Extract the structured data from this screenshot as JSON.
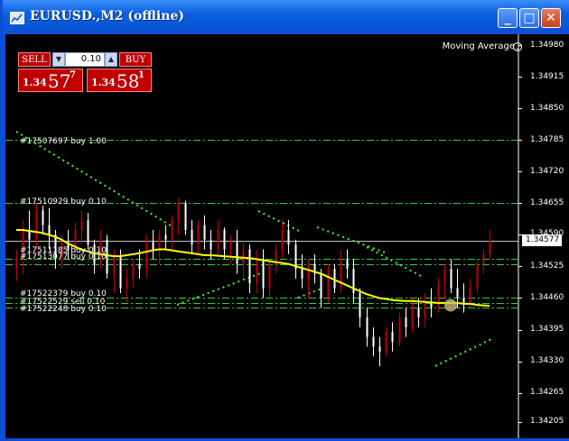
{
  "window": {
    "title": "EURUSD.,M2 (offline)"
  },
  "titlebar_buttons": {
    "minimize": "_",
    "maximize": "□",
    "close": "✕"
  },
  "trade_panel": {
    "sell_label": "SELL",
    "buy_label": "BUY",
    "lot_value": "0.10",
    "sell_price": {
      "prefix": "1.34",
      "big": "57",
      "sup": "7"
    },
    "buy_price": {
      "prefix": "1.34",
      "big": "58",
      "sup": "1"
    }
  },
  "indicator": {
    "name": "Moving Average"
  },
  "orders": [
    {
      "text": "#17507697 buy 1.00"
    },
    {
      "text": "#17510929 buy 0.10"
    },
    {
      "text": "#17511185 buy 0.10"
    },
    {
      "text": "#17513077 buy 0.10"
    },
    {
      "text": "#17522379 buy 0.10"
    },
    {
      "text": "#17522529 sell 0.10"
    },
    {
      "text": "#17522248 buy 0.10"
    }
  ],
  "price_axis": [
    "1.34980",
    "1.34915",
    "1.34850",
    "1.34785",
    "1.34720",
    "1.34655",
    "1.34590",
    "1.34525",
    "1.34460",
    "1.34395",
    "1.34330",
    "1.34265",
    "1.34205"
  ],
  "current_price": "1.34577",
  "colors": {
    "bull": "#c00000",
    "bear": "#ffffff",
    "ma": "#ffff00",
    "order_line": "#33cc33",
    "trend_dots": "#33ff33"
  },
  "chart_data": {
    "type": "candlestick",
    "symbol": "EURUSD.",
    "timeframe": "M2",
    "ylim": [
      1.34205,
      1.3498
    ],
    "y_ticks": [
      1.3498,
      1.34915,
      1.3485,
      1.34785,
      1.3472,
      1.34655,
      1.3459,
      1.34525,
      1.3446,
      1.34395,
      1.3433,
      1.34265,
      1.34205
    ],
    "current": 1.34577,
    "order_levels": [
      1.34785,
      1.34655,
      1.3454,
      1.3453,
      1.3446,
      1.3445,
      1.3444
    ],
    "ohlc": [
      {
        "o": 1.3452,
        "h": 1.3456,
        "l": 1.34495,
        "c": 1.3454
      },
      {
        "o": 1.3454,
        "h": 1.3462,
        "l": 1.3451,
        "c": 1.346
      },
      {
        "o": 1.346,
        "h": 1.3464,
        "l": 1.3456,
        "c": 1.3458
      },
      {
        "o": 1.3458,
        "h": 1.34655,
        "l": 1.3456,
        "c": 1.3464
      },
      {
        "o": 1.3464,
        "h": 1.3465,
        "l": 1.3459,
        "c": 1.3461
      },
      {
        "o": 1.3461,
        "h": 1.34645,
        "l": 1.3456,
        "c": 1.3459
      },
      {
        "o": 1.3459,
        "h": 1.346,
        "l": 1.3452,
        "c": 1.3454
      },
      {
        "o": 1.3454,
        "h": 1.3459,
        "l": 1.3452,
        "c": 1.34575
      },
      {
        "o": 1.34575,
        "h": 1.346,
        "l": 1.3454,
        "c": 1.3456
      },
      {
        "o": 1.3456,
        "h": 1.34615,
        "l": 1.3453,
        "c": 1.346
      },
      {
        "o": 1.346,
        "h": 1.3464,
        "l": 1.3457,
        "c": 1.3462
      },
      {
        "o": 1.3462,
        "h": 1.34635,
        "l": 1.3456,
        "c": 1.3457
      },
      {
        "o": 1.3457,
        "h": 1.3458,
        "l": 1.3451,
        "c": 1.3453
      },
      {
        "o": 1.3453,
        "h": 1.346,
        "l": 1.3452,
        "c": 1.3458
      },
      {
        "o": 1.3458,
        "h": 1.3459,
        "l": 1.345,
        "c": 1.3451
      },
      {
        "o": 1.3451,
        "h": 1.3456,
        "l": 1.3447,
        "c": 1.34545
      },
      {
        "o": 1.34545,
        "h": 1.3456,
        "l": 1.3447,
        "c": 1.3448
      },
      {
        "o": 1.3448,
        "h": 1.3452,
        "l": 1.3445,
        "c": 1.345
      },
      {
        "o": 1.345,
        "h": 1.3454,
        "l": 1.3448,
        "c": 1.3453
      },
      {
        "o": 1.3453,
        "h": 1.3456,
        "l": 1.345,
        "c": 1.3452
      },
      {
        "o": 1.3452,
        "h": 1.3459,
        "l": 1.345,
        "c": 1.34575
      },
      {
        "o": 1.34575,
        "h": 1.346,
        "l": 1.3454,
        "c": 1.3456
      },
      {
        "o": 1.3456,
        "h": 1.346,
        "l": 1.3453,
        "c": 1.3459
      },
      {
        "o": 1.3459,
        "h": 1.3461,
        "l": 1.3456,
        "c": 1.3458
      },
      {
        "o": 1.3458,
        "h": 1.3463,
        "l": 1.3456,
        "c": 1.3462
      },
      {
        "o": 1.3462,
        "h": 1.34665,
        "l": 1.3459,
        "c": 1.34655
      },
      {
        "o": 1.34655,
        "h": 1.3466,
        "l": 1.3459,
        "c": 1.346
      },
      {
        "o": 1.346,
        "h": 1.3462,
        "l": 1.3455,
        "c": 1.3457
      },
      {
        "o": 1.3457,
        "h": 1.3462,
        "l": 1.3455,
        "c": 1.3461
      },
      {
        "o": 1.3461,
        "h": 1.3463,
        "l": 1.3456,
        "c": 1.3458
      },
      {
        "o": 1.3458,
        "h": 1.346,
        "l": 1.3454,
        "c": 1.3456
      },
      {
        "o": 1.3456,
        "h": 1.3462,
        "l": 1.3455,
        "c": 1.346
      },
      {
        "o": 1.346,
        "h": 1.34605,
        "l": 1.3454,
        "c": 1.3456
      },
      {
        "o": 1.3456,
        "h": 1.3459,
        "l": 1.3453,
        "c": 1.34575
      },
      {
        "o": 1.34575,
        "h": 1.346,
        "l": 1.3451,
        "c": 1.3453
      },
      {
        "o": 1.3453,
        "h": 1.3458,
        "l": 1.345,
        "c": 1.3456
      },
      {
        "o": 1.3456,
        "h": 1.3457,
        "l": 1.3447,
        "c": 1.3449
      },
      {
        "o": 1.3449,
        "h": 1.3456,
        "l": 1.3447,
        "c": 1.3454
      },
      {
        "o": 1.3454,
        "h": 1.3456,
        "l": 1.3446,
        "c": 1.3448
      },
      {
        "o": 1.3448,
        "h": 1.3454,
        "l": 1.3446,
        "c": 1.3453
      },
      {
        "o": 1.3453,
        "h": 1.3457,
        "l": 1.3451,
        "c": 1.3456
      },
      {
        "o": 1.3456,
        "h": 1.3462,
        "l": 1.3454,
        "c": 1.346
      },
      {
        "o": 1.346,
        "h": 1.3462,
        "l": 1.3455,
        "c": 1.3457
      },
      {
        "o": 1.3457,
        "h": 1.3458,
        "l": 1.345,
        "c": 1.3452
      },
      {
        "o": 1.3452,
        "h": 1.3455,
        "l": 1.3448,
        "c": 1.345
      },
      {
        "o": 1.345,
        "h": 1.3454,
        "l": 1.3446,
        "c": 1.3453
      },
      {
        "o": 1.3453,
        "h": 1.3455,
        "l": 1.3449,
        "c": 1.3451
      },
      {
        "o": 1.3451,
        "h": 1.3452,
        "l": 1.3444,
        "c": 1.3446
      },
      {
        "o": 1.3446,
        "h": 1.3453,
        "l": 1.3445,
        "c": 1.3452
      },
      {
        "o": 1.3452,
        "h": 1.3453,
        "l": 1.3447,
        "c": 1.3448
      },
      {
        "o": 1.3448,
        "h": 1.3456,
        "l": 1.3447,
        "c": 1.3454
      },
      {
        "o": 1.3454,
        "h": 1.3456,
        "l": 1.345,
        "c": 1.3452
      },
      {
        "o": 1.3452,
        "h": 1.3454,
        "l": 1.3445,
        "c": 1.3447
      },
      {
        "o": 1.3447,
        "h": 1.3448,
        "l": 1.344,
        "c": 1.3442
      },
      {
        "o": 1.3442,
        "h": 1.3444,
        "l": 1.3436,
        "c": 1.3438
      },
      {
        "o": 1.3438,
        "h": 1.344,
        "l": 1.3434,
        "c": 1.3436
      },
      {
        "o": 1.3436,
        "h": 1.3438,
        "l": 1.3432,
        "c": 1.3435
      },
      {
        "o": 1.3435,
        "h": 1.344,
        "l": 1.3434,
        "c": 1.3439
      },
      {
        "o": 1.3439,
        "h": 1.3441,
        "l": 1.3435,
        "c": 1.3437
      },
      {
        "o": 1.3437,
        "h": 1.3443,
        "l": 1.3436,
        "c": 1.3442
      },
      {
        "o": 1.3442,
        "h": 1.3444,
        "l": 1.3438,
        "c": 1.344
      },
      {
        "o": 1.344,
        "h": 1.3446,
        "l": 1.3439,
        "c": 1.3444
      },
      {
        "o": 1.3444,
        "h": 1.3446,
        "l": 1.344,
        "c": 1.3442
      },
      {
        "o": 1.3442,
        "h": 1.3447,
        "l": 1.344,
        "c": 1.3445
      },
      {
        "o": 1.3445,
        "h": 1.3448,
        "l": 1.3442,
        "c": 1.3444
      },
      {
        "o": 1.3444,
        "h": 1.345,
        "l": 1.3443,
        "c": 1.3449
      },
      {
        "o": 1.3449,
        "h": 1.3453,
        "l": 1.3446,
        "c": 1.3452
      },
      {
        "o": 1.3452,
        "h": 1.3454,
        "l": 1.3447,
        "c": 1.3448
      },
      {
        "o": 1.3448,
        "h": 1.3452,
        "l": 1.3444,
        "c": 1.3446
      },
      {
        "o": 1.3446,
        "h": 1.3449,
        "l": 1.3443,
        "c": 1.3445
      },
      {
        "o": 1.3445,
        "h": 1.345,
        "l": 1.3444,
        "c": 1.3448
      },
      {
        "o": 1.3448,
        "h": 1.3454,
        "l": 1.3447,
        "c": 1.3453
      },
      {
        "o": 1.3453,
        "h": 1.3456,
        "l": 1.3451,
        "c": 1.3455
      },
      {
        "o": 1.3455,
        "h": 1.346,
        "l": 1.3454,
        "c": 1.34577
      }
    ],
    "ma": [
      1.346,
      1.346,
      1.34598,
      1.34596,
      1.34594,
      1.3459,
      1.34586,
      1.3458,
      1.34572,
      1.34566,
      1.3456,
      1.34556,
      1.34552,
      1.3455,
      1.34548,
      1.34546,
      1.34546,
      1.34548,
      1.3455,
      1.34552,
      1.34555,
      1.34558,
      1.3456,
      1.3456,
      1.34558,
      1.34556,
      1.34554,
      1.34552,
      1.3455,
      1.34548,
      1.34548,
      1.34547,
      1.34546,
      1.34545,
      1.34544,
      1.34543,
      1.34542,
      1.3454,
      1.34538,
      1.34536,
      1.34534,
      1.34532,
      1.3453,
      1.34526,
      1.34522,
      1.34518,
      1.34514,
      1.3451,
      1.34504,
      1.34498,
      1.34492,
      1.34486,
      1.3448,
      1.34474,
      1.34468,
      1.34464,
      1.3446,
      1.34458,
      1.34456,
      1.34455,
      1.34454,
      1.34454,
      1.34453,
      1.34452,
      1.34451,
      1.3445,
      1.3445,
      1.3445,
      1.3445,
      1.34448,
      1.34448,
      1.34446,
      1.34445,
      1.34444
    ]
  }
}
